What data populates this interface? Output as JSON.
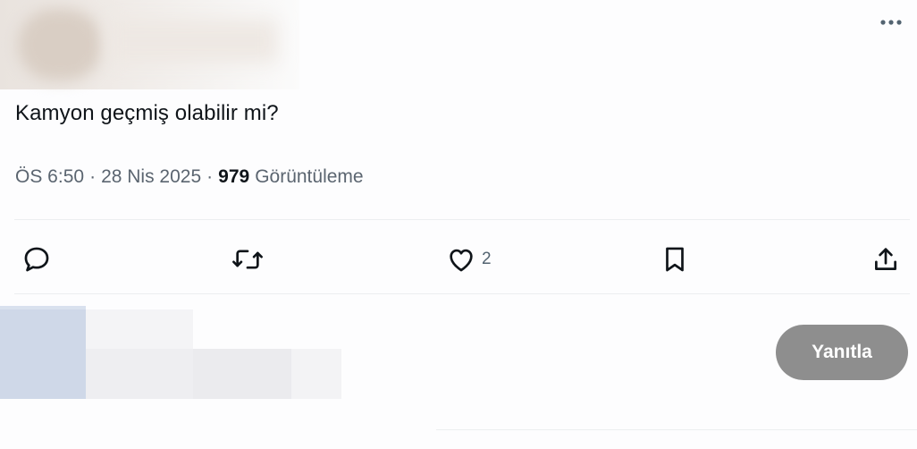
{
  "tweet": {
    "text": "Kamyon geçmiş olabilir mi?",
    "time": "ÖS 6:50",
    "date": "28 Nis 2025",
    "views_count": "979",
    "views_label": "Görüntüleme",
    "separator": "·"
  },
  "actions": {
    "reply_icon": "comment-icon",
    "retweet_icon": "retweet-icon",
    "like_icon": "heart-icon",
    "like_count": "2",
    "bookmark_icon": "bookmark-icon",
    "share_icon": "share-icon"
  },
  "composer": {
    "reply_button_label": "Yanıtla"
  },
  "colors": {
    "text": "#0f1419",
    "muted": "#5b6570",
    "reply_button": "#8e8e8e"
  }
}
